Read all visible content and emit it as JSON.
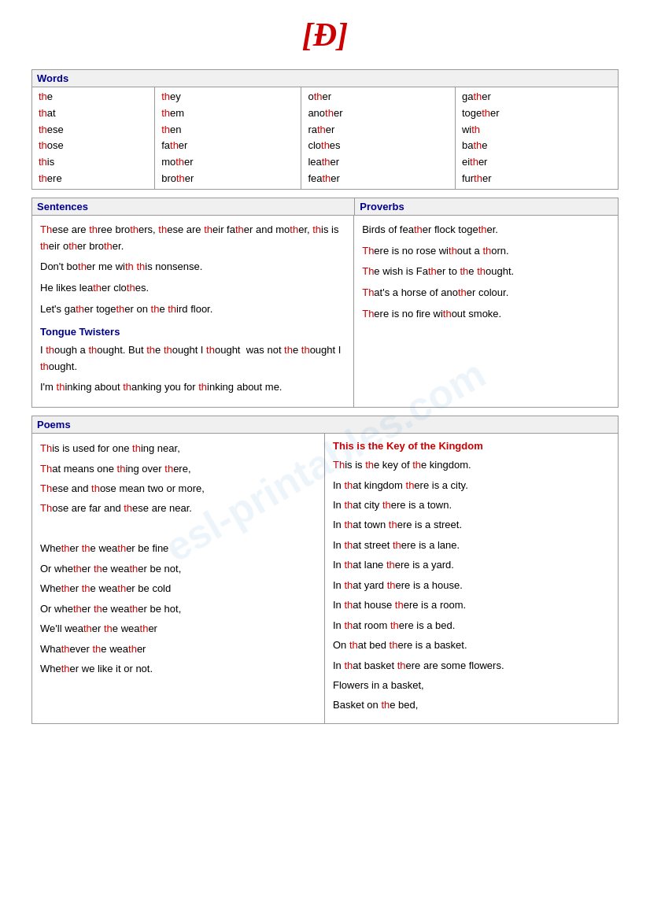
{
  "title": "[Đ]",
  "words": {
    "label": "Words",
    "columns": [
      {
        "items": [
          {
            "pre": "th",
            "th": true,
            "post": "e"
          },
          {
            "pre": "th",
            "th": true,
            "post": "at"
          },
          {
            "pre": "th",
            "th": true,
            "post": "ese"
          },
          {
            "pre": "th",
            "th": true,
            "post": "ose"
          },
          {
            "pre": "th",
            "th": true,
            "post": "is"
          },
          {
            "pre": "th",
            "th": true,
            "post": "ere"
          }
        ]
      },
      {
        "items": [
          {
            "pre": "th",
            "th": true,
            "post": "ey"
          },
          {
            "pre": "th",
            "th": true,
            "post": "em"
          },
          {
            "pre": "th",
            "th": true,
            "post": "en"
          },
          {
            "pre": "fa",
            "th": false,
            "mid": "th",
            "post": "er"
          },
          {
            "pre": "mo",
            "th": false,
            "mid": "th",
            "post": "er"
          },
          {
            "pre": "bro",
            "th": false,
            "mid": "th",
            "post": "er"
          }
        ]
      },
      {
        "items": [
          {
            "pre": "o",
            "mid": "th",
            "post": "er"
          },
          {
            "pre": "ano",
            "mid": "th",
            "post": "er"
          },
          {
            "pre": "ra",
            "mid": "th",
            "post": "er"
          },
          {
            "pre": "clo",
            "mid": "th",
            "post": "es"
          },
          {
            "pre": "lea",
            "mid": "th",
            "post": "er"
          },
          {
            "pre": "fea",
            "mid": "th",
            "post": "er"
          }
        ]
      },
      {
        "items": [
          {
            "pre": "ga",
            "mid": "th",
            "post": "er"
          },
          {
            "pre": "toge",
            "mid": "th",
            "post": "er"
          },
          {
            "pre": "wi",
            "mid": "th"
          },
          {
            "pre": "ba",
            "mid": "th",
            "post": "e"
          },
          {
            "pre": "ei",
            "mid": "th",
            "post": "er"
          },
          {
            "pre": "fur",
            "mid": "th",
            "post": "er"
          }
        ]
      }
    ]
  },
  "sentences": {
    "label": "Sentences",
    "lines": [
      "These are three brothers, these are their father and mother, this is their other brother.",
      "Don't bother me with this nonsense.",
      "He likes leather clothes.",
      "Let's gather together on the third floor."
    ]
  },
  "proverbs": {
    "label": "Proverbs",
    "lines": [
      "Birds of feather flock together.",
      "There is no rose without a thorn.",
      "The wish is Father to the thought.",
      "That's a horse of another colour.",
      "There is no fire without smoke."
    ]
  },
  "tongue_twisters": {
    "label": "Tongue Twisters",
    "texts": [
      "I though a thought. But the thought I thought  was not the thought I thought.",
      "I'm thinking about thanking you for thinking about me."
    ]
  },
  "poems": {
    "label": "Poems",
    "left": {
      "stanza1": [
        "This is used for one thing near,",
        "That means one thing over there,",
        "These and those mean two or more,",
        "Those are far and these are near."
      ],
      "stanza2": [
        "Whether the weather be fine",
        "Or whether the weather be not,",
        "Whether the weather be cold",
        "Or whether the weather be hot,",
        "We'll weather the weather",
        "Whatever the weather",
        "Whether we like it or not."
      ]
    },
    "right": {
      "title": "This is the Key of the Kingdom",
      "lines": [
        "This is the key of the kingdom.",
        "In that kingdom there is a city.",
        "In that city there is a town.",
        "In that town there is a street.",
        "In that street there is a lane.",
        "In that lane there is a yard.",
        "In that yard there is a house.",
        "In that house there is a room.",
        "In that room there is a bed.",
        "On that bed there is a basket.",
        "In that basket there are some flowers.",
        "Flowers in a basket,",
        "Basket on the bed,"
      ]
    }
  }
}
